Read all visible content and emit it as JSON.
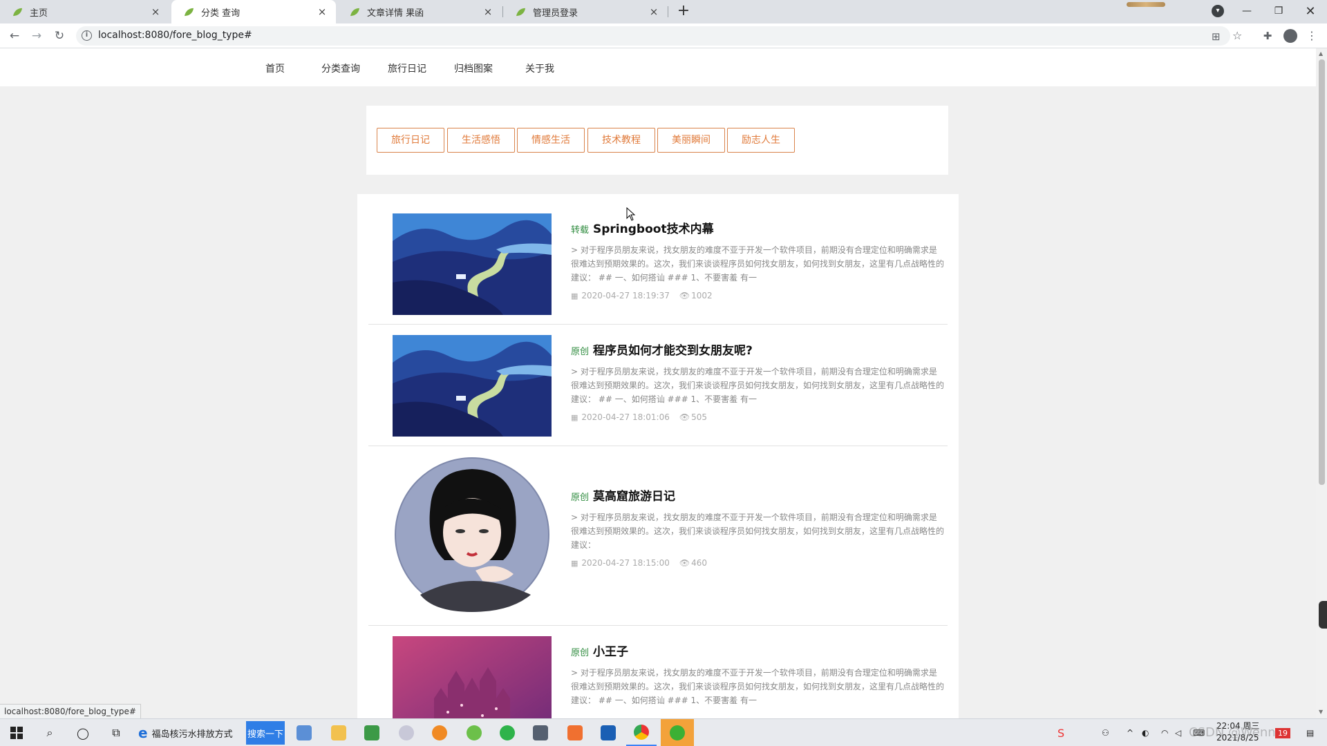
{
  "browser": {
    "tabs": [
      {
        "title": "主页",
        "active": false
      },
      {
        "title": "分类 查询",
        "active": true
      },
      {
        "title": "文章详情 果函",
        "active": false
      },
      {
        "title": "管理员登录",
        "active": false
      }
    ],
    "close_glyph": "×",
    "new_tab_glyph": "+",
    "url": "localhost:8080/fore_blog_type#",
    "status_url": "localhost:8080/fore_blog_type#",
    "icons": [
      "back-icon",
      "forward-icon",
      "reload-icon",
      "info-icon",
      "translate-icon",
      "star-icon",
      "extensions-icon",
      "profile-icon",
      "menu-icon"
    ]
  },
  "site": {
    "nav": [
      "首页",
      "分类查询",
      "旅行日记",
      "归档图案",
      "关于我"
    ],
    "categories": [
      "旅行日记",
      "生活感悟",
      "情感生活",
      "技术教程",
      "美丽瞬间",
      "励志人生"
    ],
    "accent_color": "#e07a3a",
    "tag_color": "#2e8b3e",
    "articles": [
      {
        "tag": "转载",
        "title": "Springboot技术内幕",
        "desc": "> 对于程序员朋友来说，找女朋友的难度不亚于开发一个软件项目，前期没有合理定位和明确需求是很难达到预期效果的。这次，我们来谈谈程序员如何找女朋友，如何找到女朋友，这里有几点战略性的建议：  ## 一、如何搭讪  ### 1、不要害羞  有一",
        "date": "2020-04-27 18:19:37",
        "views": "1002",
        "image": "landscape-road"
      },
      {
        "tag": "原创",
        "title": "程序员如何才能交到女朋友呢?",
        "desc": "> 对于程序员朋友来说，找女朋友的难度不亚于开发一个软件项目，前期没有合理定位和明确需求是很难达到预期效果的。这次，我们来谈谈程序员如何找女朋友，如何找到女朋友，这里有几点战略性的建议：  ## 一、如何搭讪  ### 1、不要害羞  有一",
        "date": "2020-04-27 18:01:06",
        "views": "505",
        "image": "landscape-road"
      },
      {
        "tag": "原创",
        "title": "莫高窟旅游日记",
        "desc": "> 对于程序员朋友来说，找女朋友的难度不亚于开发一个软件项目，前期没有合理定位和明确需求是很难达到预期效果的。这次，我们来谈谈程序员如何找女朋友，如何找到女朋友，这里有几点战略性的建议：",
        "date": "2020-04-27 18:15:00",
        "views": "460",
        "image": "girl-portrait"
      },
      {
        "tag": "原创",
        "title": "小王子",
        "desc": "> 对于程序员朋友来说，找女朋友的难度不亚于开发一个软件项目，前期没有合理定位和明确需求是很难达到预期效果的。这次，我们来谈谈程序员如何找女朋友，如何找到女朋友，这里有几点战略性的建议：  ## 一、如何搭讪  ### 1、不要害羞  有一",
        "date": "",
        "views": "",
        "image": "pink-castle"
      }
    ]
  },
  "taskbar": {
    "ie_label": "福岛核污水排放方式",
    "search_label": "搜索一下",
    "time": "22:04 周三",
    "date": "2021/8/25",
    "watermark": "CSDN @Wenn"
  }
}
